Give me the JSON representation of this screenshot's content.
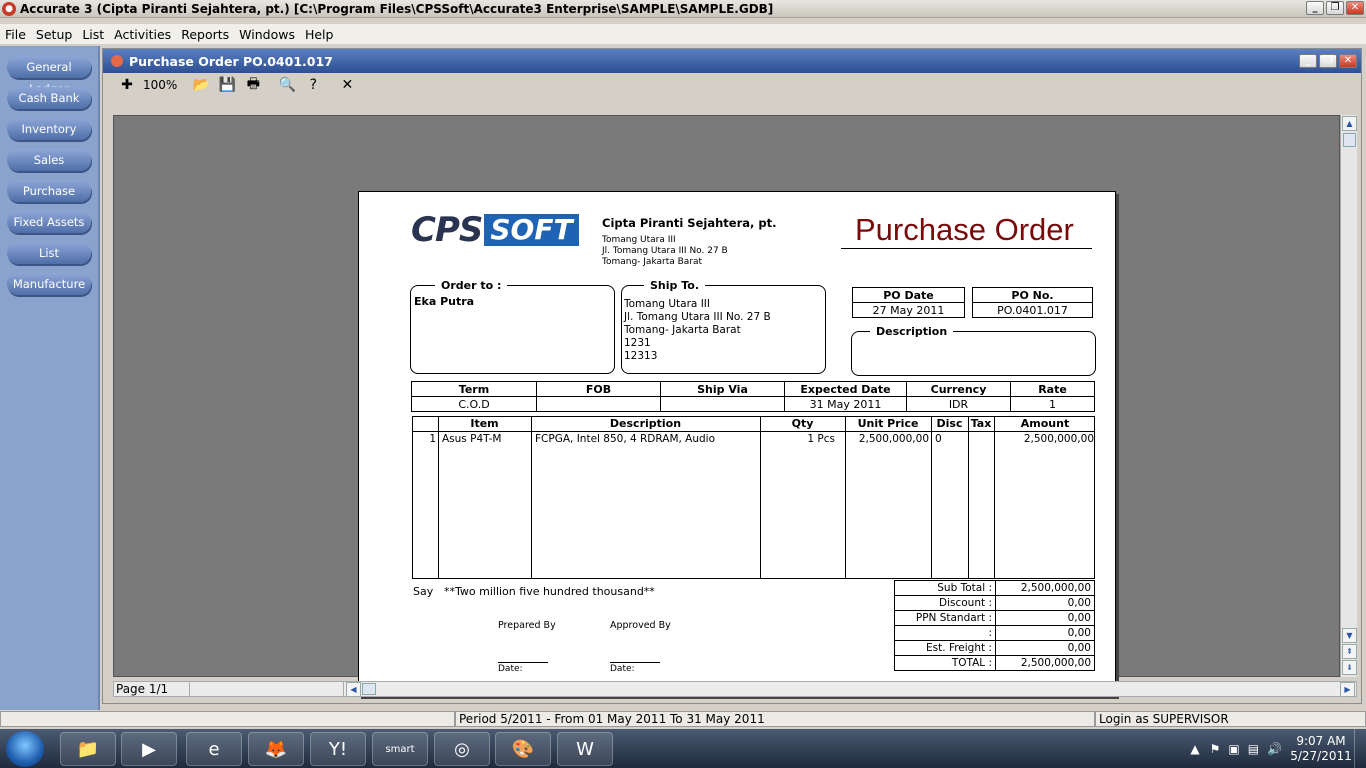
{
  "app": {
    "title": "Accurate 3  (Cipta Piranti Sejahtera, pt.)  [C:\\Program Files\\CPSSoft\\Accurate3 Enterprise\\SAMPLE\\SAMPLE.GDB]"
  },
  "menu": {
    "items": [
      {
        "label": "File"
      },
      {
        "label": "Setup"
      },
      {
        "label": "List"
      },
      {
        "label": "Activities"
      },
      {
        "label": "Reports"
      },
      {
        "label": "Windows"
      },
      {
        "label": "Help"
      }
    ]
  },
  "sidebar": {
    "items": [
      {
        "label": "General Ledger"
      },
      {
        "label": "Cash Bank"
      },
      {
        "label": "Inventory"
      },
      {
        "label": "Sales"
      },
      {
        "label": "Purchase"
      },
      {
        "label": "Fixed Assets"
      },
      {
        "label": "List"
      },
      {
        "label": "Manufacture"
      }
    ]
  },
  "child": {
    "title": "Purchase Order PO.0401.017",
    "zoom": "100%"
  },
  "doc": {
    "logo_left": "CPS",
    "logo_right": "SOFT",
    "company_name": "Cipta Piranti Sejahtera, pt.",
    "company_addr": [
      "Tomang Utara III",
      "Jl. Tomang Utara III No. 27 B",
      "Tomang- Jakarta Barat"
    ],
    "title": "Purchase Order",
    "order_to_label": "Order to :",
    "order_to_name": "Eka Putra",
    "ship_to_label": "Ship To.",
    "ship_to_lines": [
      "Tomang Utara III",
      "Jl. Tomang Utara III No. 27 B",
      "Tomang- Jakarta Barat",
      "1231",
      "12313"
    ],
    "po_date_label": "PO Date",
    "po_date": "27 May 2011",
    "po_no_label": "PO No.",
    "po_no": "PO.0401.017",
    "description_label": "Description",
    "terms": {
      "headers": [
        "Term",
        "FOB",
        "Ship Via",
        "Expected Date",
        "Currency",
        "Rate"
      ],
      "values": [
        "C.O.D",
        "",
        "",
        "31 May 2011",
        "IDR",
        "1"
      ]
    },
    "items": {
      "headers": [
        "Item",
        "Description",
        "Qty",
        "Unit Price",
        "Disc",
        "Tax",
        "Amount"
      ],
      "rows": [
        {
          "no": "1",
          "item": "Asus P4T-M",
          "desc": "FCPGA, Intel 850, 4 RDRAM, Audio",
          "qty": "1 Pcs",
          "price": "2,500,000,00",
          "disc": "0",
          "tax": "",
          "amount": "2,500,000,00"
        }
      ]
    },
    "say_label": "Say",
    "say_text": "**Two million five hundred thousand**",
    "prepared_by": "Prepared By",
    "approved_by": "Approved By",
    "date_label": "Date:",
    "summary": [
      {
        "label": "Sub Total :",
        "value": "2,500,000,00"
      },
      {
        "label": "Discount :",
        "value": "0,00"
      },
      {
        "label": "PPN Standart :",
        "value": "0,00"
      },
      {
        "label": ":",
        "value": "0,00"
      },
      {
        "label": "Est. Freight :",
        "value": "0,00"
      },
      {
        "label": "TOTAL :",
        "value": "2,500,000,00"
      }
    ]
  },
  "viewer": {
    "page_label": "Page 1/1"
  },
  "status": {
    "period": "Period 5/2011 - From 01 May 2011 To 31 May 2011",
    "login": "Login as SUPERVISOR"
  },
  "taskbar": {
    "time": "9:07 AM",
    "date": "5/27/2011",
    "smart_label": "smart"
  }
}
